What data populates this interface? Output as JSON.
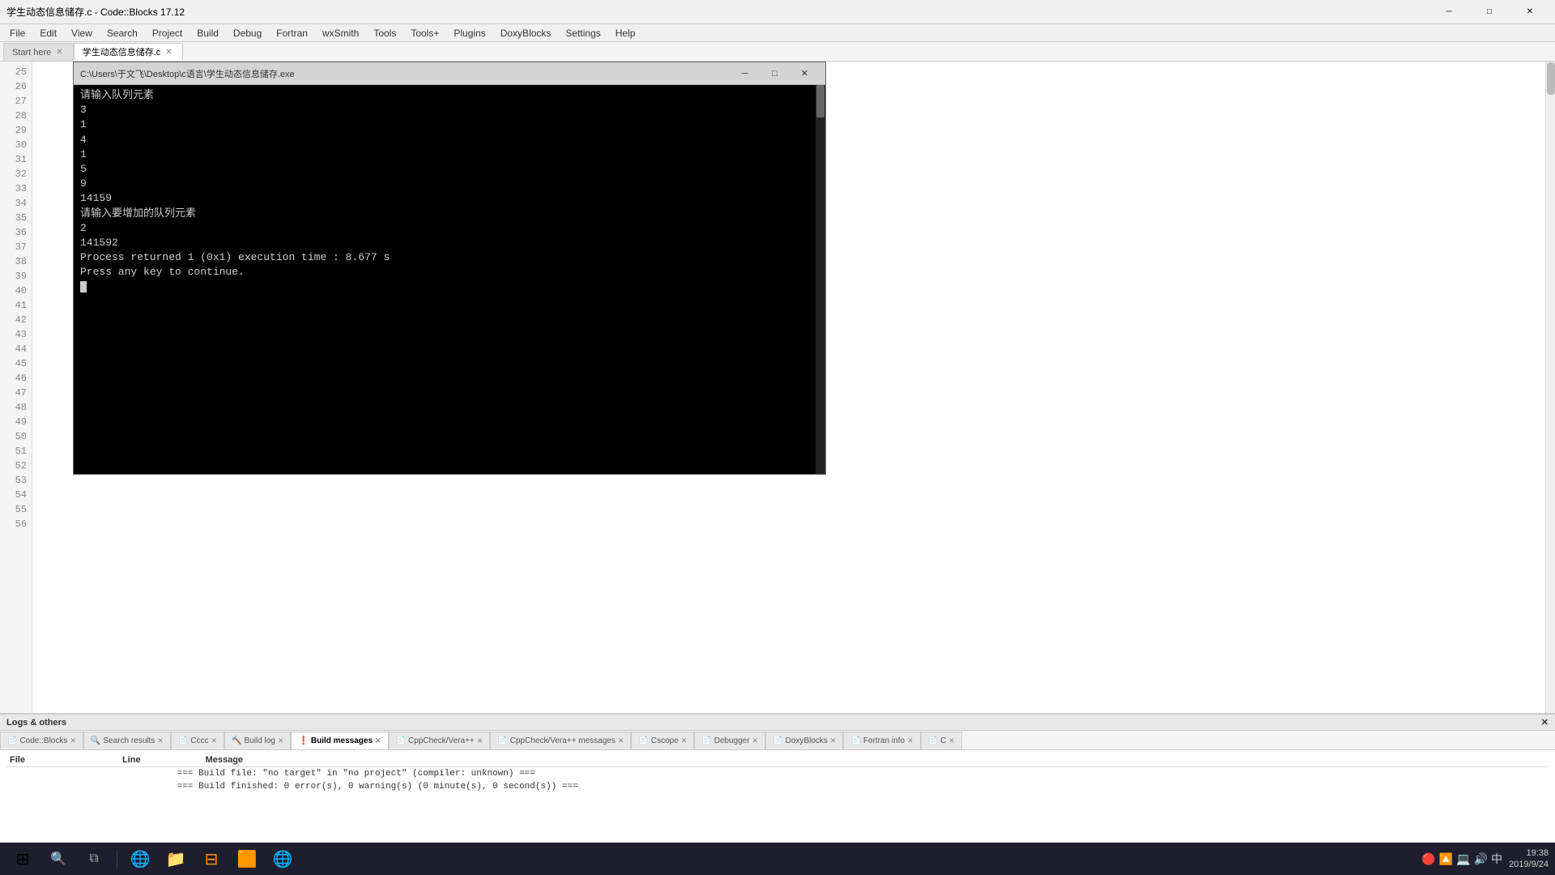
{
  "window": {
    "title": "学生动态信息储存.c - Code::Blocks 17.12",
    "controls": {
      "minimize": "─",
      "maximize": "□",
      "close": "✕"
    }
  },
  "menu": {
    "items": [
      "File",
      "Edit",
      "View",
      "Search",
      "Project",
      "Build",
      "Debug",
      "Fortran",
      "wxSmith",
      "Tools",
      "Tools+",
      "Plugins",
      "DoxyBlocks",
      "Settings",
      "Help"
    ]
  },
  "tabs": [
    {
      "label": "Start here",
      "active": false,
      "closable": true
    },
    {
      "label": "学生动态信息储存.c",
      "active": true,
      "closable": true
    }
  ],
  "line_numbers": [
    25,
    26,
    27,
    28,
    29,
    30,
    31,
    32,
    33,
    34,
    35,
    36,
    37,
    38,
    39,
    40,
    41,
    42,
    43,
    44,
    45,
    46,
    47,
    48,
    49,
    50,
    51,
    52,
    53,
    54,
    55,
    56
  ],
  "terminal": {
    "title": "C:\\Users\\于文飞\\Desktop\\c语言\\学生动态信息储存.exe",
    "controls": {
      "minimize": "─",
      "maximize": "□",
      "close": "✕"
    },
    "output": [
      "请输入队列元素",
      "3",
      "1",
      "4",
      "1",
      "5",
      "9",
      "14159",
      "请输入要增加的队列元素",
      "2",
      "141592",
      "Process returned 1 (0x1)   execution time : 8.677 s",
      "Press any key to continue."
    ]
  },
  "logs_panel": {
    "header": "Logs & others",
    "close_label": "✕",
    "tabs": [
      {
        "label": "Code::Blocks",
        "icon": "📄",
        "active": false,
        "closable": true
      },
      {
        "label": "Search results",
        "icon": "🔍",
        "active": false,
        "closable": true
      },
      {
        "label": "Cccc",
        "icon": "📄",
        "active": false,
        "closable": true
      },
      {
        "label": "Build log",
        "icon": "🔨",
        "active": false,
        "closable": true
      },
      {
        "label": "Build messages",
        "icon": "❗",
        "active": true,
        "closable": true
      },
      {
        "label": "CppCheck/Vera++",
        "icon": "📄",
        "active": false,
        "closable": true
      },
      {
        "label": "CppCheck/Vera++ messages",
        "icon": "📄",
        "active": false,
        "closable": true
      },
      {
        "label": "Cscope",
        "icon": "📄",
        "active": false,
        "closable": true
      },
      {
        "label": "Debugger",
        "icon": "📄",
        "active": false,
        "closable": true
      },
      {
        "label": "DoxyBlocks",
        "icon": "📄",
        "active": false,
        "closable": true
      },
      {
        "label": "Fortran info",
        "icon": "📄",
        "active": false,
        "closable": true
      }
    ],
    "table_headers": [
      "File",
      "Line",
      "Message"
    ],
    "rows": [
      {
        "file": "",
        "line": "",
        "message": "=== Build file: \"no target\" in \"no project\" (compiler: unknown) ==="
      },
      {
        "file": "",
        "line": "",
        "message": "=== Build finished: 0 error(s), 0 warning(s) (0 minute(s), 0 second(s)) ==="
      }
    ]
  },
  "taskbar": {
    "clock": {
      "time": "19:38",
      "date": "2019/9/24"
    },
    "systray_icons": [
      "🔴",
      "🔼",
      "💻",
      "🔊",
      "中"
    ],
    "taskbar_apps": [
      "⊞",
      "🌐",
      "⊟",
      "🟧",
      "🌐"
    ]
  }
}
